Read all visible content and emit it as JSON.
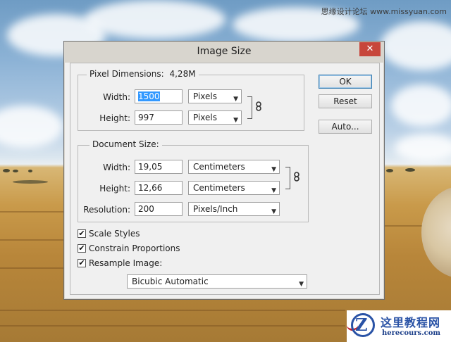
{
  "watermark_top": "思缘设计论坛 www.missyuan.com",
  "logo": {
    "cn": "这里教程网",
    "en": "herecours.com"
  },
  "dialog": {
    "title": "Image Size",
    "close_glyph": "✕",
    "pixel_dimensions": {
      "legend": "Pixel Dimensions:",
      "size": "4,28M",
      "width_label": "Width:",
      "width_value": "1500",
      "width_unit": "Pixels",
      "height_label": "Height:",
      "height_value": "997",
      "height_unit": "Pixels"
    },
    "document_size": {
      "legend": "Document Size:",
      "width_label": "Width:",
      "width_value": "19,05",
      "width_unit": "Centimeters",
      "height_label": "Height:",
      "height_value": "12,66",
      "height_unit": "Centimeters",
      "resolution_label": "Resolution:",
      "resolution_value": "200",
      "resolution_unit": "Pixels/Inch"
    },
    "checkboxes": [
      {
        "label": "Scale Styles",
        "checked": true
      },
      {
        "label": "Constrain Proportions",
        "checked": true
      },
      {
        "label": "Resample Image:",
        "checked": true
      }
    ],
    "resample_method": "Bicubic Automatic",
    "buttons": {
      "ok": "OK",
      "reset": "Reset",
      "auto": "Auto..."
    },
    "icons": {
      "chain": "chain-link-icon",
      "check": "check-icon",
      "dropdown": "chevron-down-icon",
      "close": "close-icon"
    }
  }
}
